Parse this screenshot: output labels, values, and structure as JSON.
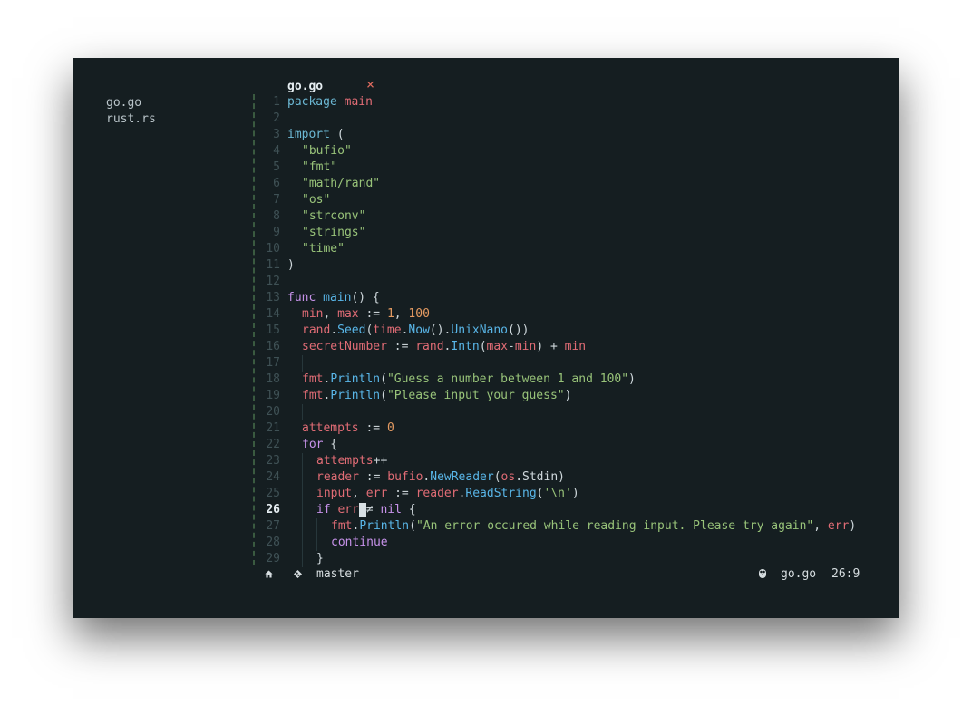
{
  "sidebar": {
    "files": [
      "go.go",
      "rust.rs"
    ]
  },
  "tab": {
    "name": "go.go",
    "close_glyph": "×"
  },
  "editor": {
    "active_line": 26,
    "lines": [
      {
        "n": "1",
        "i": 0,
        "t": [
          [
            "package ",
            "kw"
          ],
          [
            "main",
            "var"
          ]
        ]
      },
      {
        "n": "2",
        "i": 0,
        "t": []
      },
      {
        "n": "3",
        "i": 0,
        "t": [
          [
            "import",
            "kw"
          ],
          [
            " (",
            "plain"
          ]
        ]
      },
      {
        "n": "4",
        "i": 1,
        "t": [
          [
            "\"bufio\"",
            "str"
          ]
        ]
      },
      {
        "n": "5",
        "i": 1,
        "t": [
          [
            "\"fmt\"",
            "str"
          ]
        ]
      },
      {
        "n": "6",
        "i": 1,
        "t": [
          [
            "\"math/rand\"",
            "str"
          ]
        ]
      },
      {
        "n": "7",
        "i": 1,
        "t": [
          [
            "\"os\"",
            "str"
          ]
        ]
      },
      {
        "n": "8",
        "i": 1,
        "t": [
          [
            "\"strconv\"",
            "str"
          ]
        ]
      },
      {
        "n": "9",
        "i": 1,
        "t": [
          [
            "\"strings\"",
            "str"
          ]
        ]
      },
      {
        "n": "10",
        "i": 1,
        "t": [
          [
            "\"time\"",
            "str"
          ]
        ]
      },
      {
        "n": "11",
        "i": 0,
        "t": [
          [
            ")",
            "plain"
          ]
        ]
      },
      {
        "n": "12",
        "i": 0,
        "t": []
      },
      {
        "n": "13",
        "i": 0,
        "t": [
          [
            "func ",
            "kw2"
          ],
          [
            "main",
            "fn"
          ],
          [
            "() {",
            "plain"
          ]
        ]
      },
      {
        "n": "14",
        "i": 1,
        "t": [
          [
            "min",
            "var"
          ],
          [
            ", ",
            "plain"
          ],
          [
            "max",
            "var"
          ],
          [
            " := ",
            "op"
          ],
          [
            "1",
            "num"
          ],
          [
            ", ",
            "plain"
          ],
          [
            "100",
            "num"
          ]
        ]
      },
      {
        "n": "15",
        "i": 1,
        "t": [
          [
            "rand",
            "var"
          ],
          [
            ".",
            "plain"
          ],
          [
            "Seed",
            "fn"
          ],
          [
            "(",
            "plain"
          ],
          [
            "time",
            "var"
          ],
          [
            ".",
            "plain"
          ],
          [
            "Now",
            "fn"
          ],
          [
            "().",
            "plain"
          ],
          [
            "UnixNano",
            "fn"
          ],
          [
            "())",
            "plain"
          ]
        ]
      },
      {
        "n": "16",
        "i": 1,
        "t": [
          [
            "secretNumber",
            "var"
          ],
          [
            " := ",
            "op"
          ],
          [
            "rand",
            "var"
          ],
          [
            ".",
            "plain"
          ],
          [
            "Intn",
            "fn"
          ],
          [
            "(",
            "plain"
          ],
          [
            "max",
            "var"
          ],
          [
            "-",
            "op"
          ],
          [
            "min",
            "var"
          ],
          [
            ") + ",
            "plain"
          ],
          [
            "min",
            "var"
          ]
        ]
      },
      {
        "n": "17",
        "i": 2,
        "t": []
      },
      {
        "n": "18",
        "i": 1,
        "t": [
          [
            "fmt",
            "var"
          ],
          [
            ".",
            "plain"
          ],
          [
            "Println",
            "fn"
          ],
          [
            "(",
            "plain"
          ],
          [
            "\"Guess a number between 1 and 100\"",
            "str"
          ],
          [
            ")",
            "plain"
          ]
        ]
      },
      {
        "n": "19",
        "i": 1,
        "t": [
          [
            "fmt",
            "var"
          ],
          [
            ".",
            "plain"
          ],
          [
            "Println",
            "fn"
          ],
          [
            "(",
            "plain"
          ],
          [
            "\"Please input your guess\"",
            "str"
          ],
          [
            ")",
            "plain"
          ]
        ]
      },
      {
        "n": "20",
        "i": 2,
        "t": []
      },
      {
        "n": "21",
        "i": 1,
        "t": [
          [
            "attempts",
            "var"
          ],
          [
            " := ",
            "op"
          ],
          [
            "0",
            "num"
          ]
        ]
      },
      {
        "n": "22",
        "i": 1,
        "t": [
          [
            "for",
            "kw2"
          ],
          [
            " {",
            "plain"
          ]
        ]
      },
      {
        "n": "23",
        "i": 2,
        "t": [
          [
            "attempts",
            "var"
          ],
          [
            "++",
            "op"
          ]
        ]
      },
      {
        "n": "24",
        "i": 2,
        "t": [
          [
            "reader",
            "var"
          ],
          [
            " := ",
            "op"
          ],
          [
            "bufio",
            "var"
          ],
          [
            ".",
            "plain"
          ],
          [
            "NewReader",
            "fn"
          ],
          [
            "(",
            "plain"
          ],
          [
            "os",
            "var"
          ],
          [
            ".Stdin)",
            "plain"
          ]
        ]
      },
      {
        "n": "25",
        "i": 2,
        "t": [
          [
            "input",
            "var"
          ],
          [
            ", ",
            "plain"
          ],
          [
            "err",
            "var"
          ],
          [
            " := ",
            "op"
          ],
          [
            "reader",
            "var"
          ],
          [
            ".",
            "plain"
          ],
          [
            "ReadString",
            "fn"
          ],
          [
            "(",
            "plain"
          ],
          [
            "'\\n'",
            "str"
          ],
          [
            ")",
            "plain"
          ]
        ]
      },
      {
        "n": "26",
        "i": 2,
        "t": [
          [
            "if ",
            "kw2"
          ],
          [
            "err",
            "var"
          ],
          [
            " ",
            "cursor"
          ],
          [
            "≠ ",
            "op"
          ],
          [
            "nil",
            "kw2"
          ],
          [
            " {",
            "plain"
          ]
        ]
      },
      {
        "n": "27",
        "i": 3,
        "t": [
          [
            "fmt",
            "var"
          ],
          [
            ".",
            "plain"
          ],
          [
            "Println",
            "fn"
          ],
          [
            "(",
            "plain"
          ],
          [
            "\"An error occured while reading input. Please try again\"",
            "str"
          ],
          [
            ", ",
            "plain"
          ],
          [
            "err",
            "var"
          ],
          [
            ")",
            "plain"
          ]
        ]
      },
      {
        "n": "28",
        "i": 3,
        "t": [
          [
            "continue",
            "kw2"
          ]
        ]
      },
      {
        "n": "29",
        "i": 2,
        "t": [
          [
            "}",
            "plain"
          ]
        ]
      }
    ]
  },
  "status": {
    "home_icon": "home-icon",
    "branch_icon": "git-branch-icon",
    "branch": "master",
    "lang_icon": "go-gopher-icon",
    "file": "go.go",
    "position": "26:9"
  }
}
